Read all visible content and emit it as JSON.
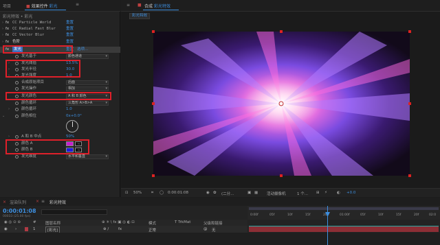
{
  "left_panel": {
    "tabs": [
      "项目",
      "效果控件",
      "彩光"
    ],
    "breadcrumb": "彩光特效 • 彩光",
    "effects": [
      {
        "name": "CC Particle World",
        "reset": "重置"
      },
      {
        "name": "CC Radial Fast Blur",
        "reset": "重置"
      },
      {
        "name": "CC Vector Blur",
        "reset": "重置"
      },
      {
        "name": "色阶",
        "reset": "重置"
      },
      {
        "name": "发光",
        "reset": "重置",
        "options": "选项..."
      }
    ],
    "glow_props": [
      {
        "label": "发光基于",
        "value": "颜色通道",
        "type": "select"
      },
      {
        "label": "发光阈值",
        "value": "13.5%",
        "type": "value"
      },
      {
        "label": "发光半径",
        "value": "30.0",
        "type": "value"
      },
      {
        "label": "发光强度",
        "value": "1.0",
        "type": "value"
      },
      {
        "label": "合成原始项目",
        "value": "后面",
        "type": "select"
      },
      {
        "label": "发光操作",
        "value": "相加",
        "type": "select"
      },
      {
        "label": "发光颜色",
        "value": "A 和 B 颜色",
        "type": "select"
      },
      {
        "label": "颜色循环",
        "value": "三角形 A>B>A",
        "type": "select"
      },
      {
        "label": "颜色循环",
        "value": "1.0",
        "type": "value"
      },
      {
        "label": "颜色相位",
        "value": "0x+0.0°",
        "type": "value"
      },
      {
        "label": "A 和 B 中点",
        "value": "50%",
        "type": "value"
      },
      {
        "label": "颜色 A",
        "color": "#c81fd0",
        "type": "color"
      },
      {
        "label": "颜色 B",
        "color": "#1d1be0",
        "type": "color"
      },
      {
        "label": "发光维度",
        "value": "水平和垂直",
        "type": "select"
      }
    ]
  },
  "viewer": {
    "tabs": [
      "合成",
      "彩光特效"
    ],
    "comp_chip": "彩光特效",
    "toolbar": {
      "zoom": "50%",
      "timecode": "0:00:01:08",
      "resolution": "(二分...",
      "camera": "活动摄像机",
      "views": "1 个...",
      "exposure": "+0.0"
    }
  },
  "timeline": {
    "tabs": [
      "渲染队列",
      "彩光特效"
    ],
    "timecode": "0:00:01:08",
    "frames_sub": "00033 (25.00 fps)",
    "columns": {
      "num": "#",
      "layer_name": "图层名称",
      "mode": "模式",
      "trkmat": "T TrkMat",
      "parent": "父级和链接"
    },
    "layer": {
      "index": "1",
      "name": "[彩光]",
      "mode": "正常",
      "parent": "无"
    },
    "ruler": [
      "0:00f",
      "05f",
      "10f",
      "15f",
      "20f",
      "01:00f",
      "05f",
      "10f",
      "15f",
      "20f",
      "02:0"
    ]
  },
  "colors": {
    "accent": "#3d8fe0",
    "highlight_box": "#e0202a",
    "layer_bar": "#8c2e35"
  }
}
